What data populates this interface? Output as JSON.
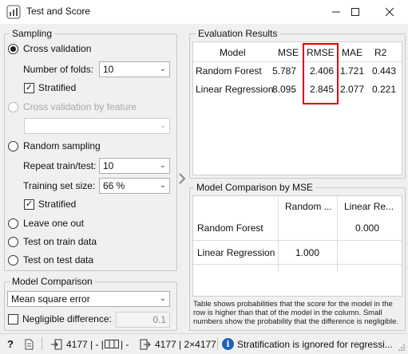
{
  "window": {
    "title": "Test and Score",
    "app_icon": "orange-widget-icon",
    "controls": {
      "minimize": "–",
      "maximize": "☐",
      "close": "✕"
    }
  },
  "sampling": {
    "group_title": "Sampling",
    "cross_validation": {
      "label": "Cross validation",
      "selected": true
    },
    "folds_label": "Number of folds:",
    "folds_value": "10",
    "stratified_cv": {
      "label": "Stratified",
      "checked": true
    },
    "cv_by_feature": {
      "label": "Cross validation by feature",
      "enabled": false
    },
    "feature_value": "",
    "random_sampling": {
      "label": "Random sampling",
      "selected": false
    },
    "repeat_label": "Repeat train/test:",
    "repeat_value": "10",
    "training_label": "Training set size:",
    "training_value": "66 %",
    "stratified_rs": {
      "label": "Stratified",
      "checked": true
    },
    "leave_one_out": {
      "label": "Leave one out",
      "selected": false
    },
    "train_data": {
      "label": "Test on train data",
      "selected": false
    },
    "test_data": {
      "label": "Test on test data",
      "selected": false
    }
  },
  "model_comparison": {
    "group_title": "Model Comparison",
    "metric": "Mean square error",
    "negligible_label": "Negligible difference:",
    "negligible_value": "0.1"
  },
  "evaluation": {
    "group_title": "Evaluation Results",
    "headers": [
      "Model",
      "MSE",
      "RMSE",
      "MAE",
      "R2"
    ],
    "rows": [
      [
        "Random Forest",
        "5.787",
        "2.406",
        "1.721",
        "0.443"
      ],
      [
        "Linear Regression",
        "8.095",
        "2.845",
        "2.077",
        "0.221"
      ]
    ],
    "highlight_color": "#e00000"
  },
  "comparison": {
    "group_title": "Model Comparison by MSE",
    "col_headers": [
      "Random ...",
      "Linear Re..."
    ],
    "rows": [
      {
        "model": "Random Forest",
        "values": [
          "",
          "0.000"
        ]
      },
      {
        "model": "Linear Regression",
        "values": [
          "1.000",
          ""
        ]
      }
    ],
    "note": "Table shows probabilities that the score for the model in the row is higher than that of the model in the column. Small numbers show the probability that the difference is negligible."
  },
  "statusbar": {
    "help_icon": "?",
    "input_text": "4177 | - |",
    "input_text2": "| -",
    "output_text": "4177 | 2×4177",
    "info_icon": "i",
    "message": "Stratification is ignored for regressi..."
  }
}
